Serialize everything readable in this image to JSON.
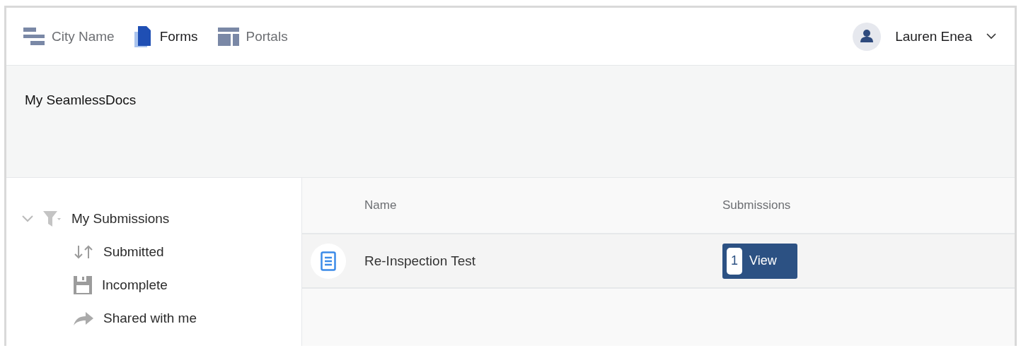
{
  "nav": {
    "items": [
      {
        "label": "City Name",
        "kind": "city",
        "selected": false
      },
      {
        "label": "Forms",
        "kind": "forms",
        "selected": true
      },
      {
        "label": "Portals",
        "kind": "portals",
        "selected": false
      }
    ],
    "user": {
      "name": "Lauren Enea"
    }
  },
  "banner": {
    "title": "My SeamlessDocs"
  },
  "sidebar": {
    "items": [
      {
        "label": "My Submissions",
        "kind": "filter",
        "expanded": true,
        "children": [
          {
            "label": "Submitted",
            "kind": "sort"
          },
          {
            "label": "Incomplete",
            "kind": "save"
          },
          {
            "label": "Shared with me",
            "kind": "share"
          }
        ]
      }
    ]
  },
  "table": {
    "columns": [
      "Name",
      "Submissions"
    ],
    "rows": [
      {
        "name": "Re-Inspection Test",
        "count": "1",
        "action": "View"
      }
    ]
  }
}
